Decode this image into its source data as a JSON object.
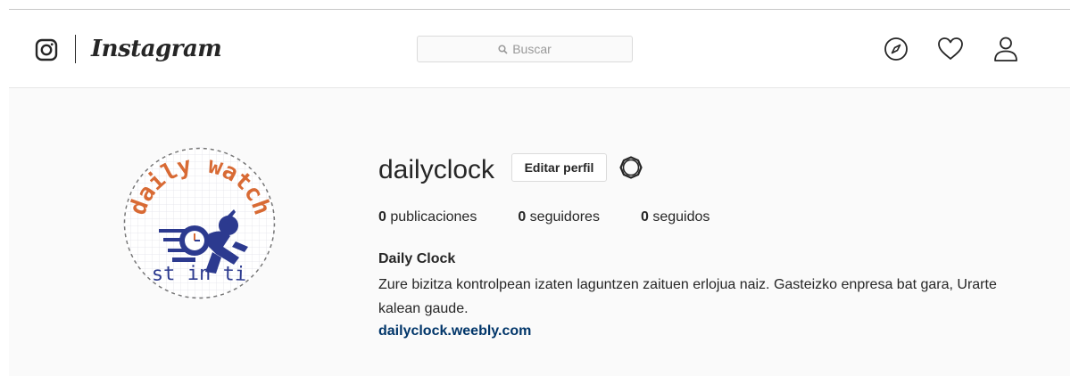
{
  "header": {
    "brand": "Instagram",
    "search": {
      "placeholder": "Buscar"
    },
    "nav": {
      "explore_icon": "compass-icon",
      "activity_icon": "heart-icon",
      "profile_icon": "user-icon"
    }
  },
  "profile": {
    "username": "dailyclock",
    "edit_button": "Editar perfil",
    "options_icon": "gear-icon",
    "stats": {
      "posts": {
        "count": "0",
        "label": "publicaciones"
      },
      "followers": {
        "count": "0",
        "label": "seguidores"
      },
      "following": {
        "count": "0",
        "label": "seguidos"
      }
    },
    "full_name": "Daily Clock",
    "bio": "Zure bizitza kontrolpean izaten laguntzen zaituen erlojua naiz. Gasteizko enpresa bat gara, Urarte kalean gaude.",
    "website": "dailyclock.weebly.com",
    "avatar": {
      "top_text": "daily watch",
      "bottom_text": "just in time"
    }
  },
  "colors": {
    "link": "#003569",
    "avatar_orange": "#d86a34",
    "avatar_blue": "#2c3a8f"
  }
}
